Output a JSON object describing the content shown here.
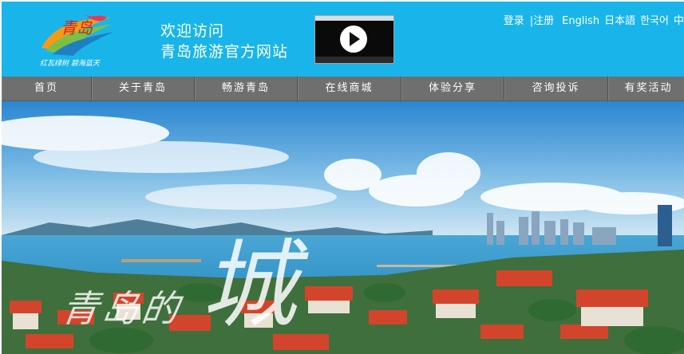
{
  "header": {
    "logo_text": "青岛",
    "logo_slogan": "红瓦绿树 碧海蓝天",
    "welcome_line1": "欢迎访问",
    "welcome_line2": "青岛旅游官方网站",
    "login": "登录",
    "register": "|注册",
    "languages": [
      "English",
      "日本語",
      "한국어",
      "中"
    ]
  },
  "nav": {
    "items": [
      "首页",
      "关于青岛",
      "畅游青岛",
      "在线商城",
      "体验分享",
      "咨询投诉",
      "有奖活动"
    ]
  },
  "banner": {
    "calligraphy_small": "青岛的",
    "calligraphy_big": "城"
  },
  "colors": {
    "header_bg": "#19b5ea",
    "nav_bg": "#6f6f6f",
    "sea": "#3a9ecf",
    "roof_red": "#d2452c"
  },
  "icons": [
    "play-icon"
  ]
}
